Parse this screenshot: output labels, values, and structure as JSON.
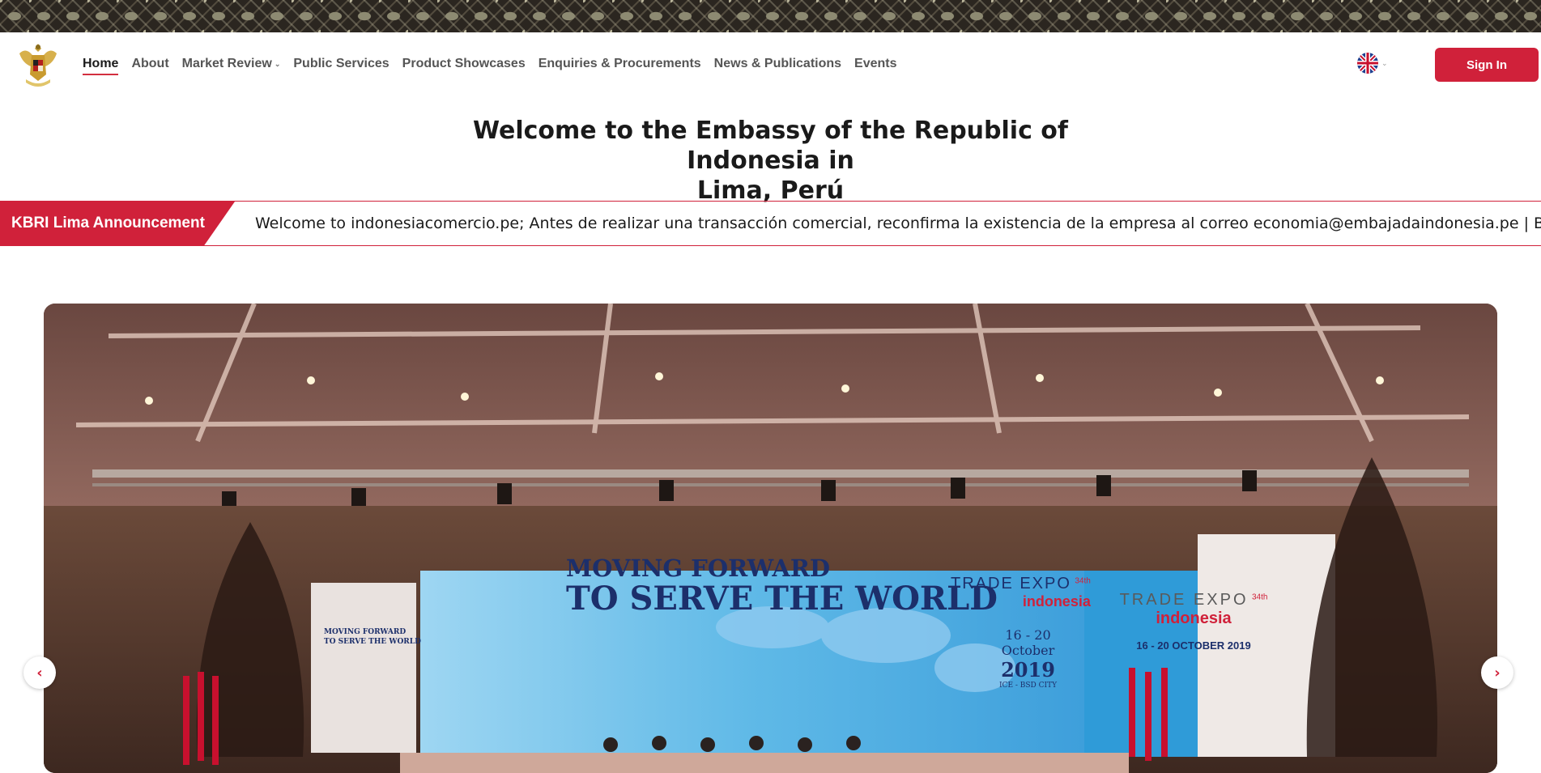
{
  "nav": {
    "items": [
      {
        "label": "Home",
        "active": true
      },
      {
        "label": "About"
      },
      {
        "label": "Market Review",
        "has_dropdown": true
      },
      {
        "label": "Public Services"
      },
      {
        "label": "Product Showcases"
      },
      {
        "label": "Enquiries & Procurements"
      },
      {
        "label": "News & Publications"
      },
      {
        "label": "Events"
      }
    ],
    "language_icon": "uk-flag-icon",
    "sign_in_label": "Sign In"
  },
  "page": {
    "title_line1": "Welcome to the Embassy of the Republic of Indonesia in",
    "title_line2": "Lima, Perú"
  },
  "announcement": {
    "label": "KBRI Lima Announcement",
    "text": "Welcome to indonesiacomercio.pe; Antes de realizar una transacción comercial, reconfirma la existencia de la empresa al correo economia@embajadaindonesia.pe | Before making a c"
  },
  "hero": {
    "banner_headline_1": "MOVING FORWARD",
    "banner_headline_2": "TO SERVE THE WORLD",
    "side_headline_1": "MOVING FORWARD",
    "side_headline_2": "TO SERVE THE WORLD",
    "event_name": "TRADE EXPO",
    "event_edition": "34th",
    "event_country": "indonesia",
    "dates_line1": "16 - 20",
    "dates_line2": "October",
    "dates_line3": "2019",
    "venue": "ICE - BSD CITY",
    "right_banner_dates": "16 - 20 OCTOBER 2019"
  },
  "colors": {
    "accent": "#d0213a",
    "text": "#1a1a1a",
    "nav_text": "#555555"
  }
}
